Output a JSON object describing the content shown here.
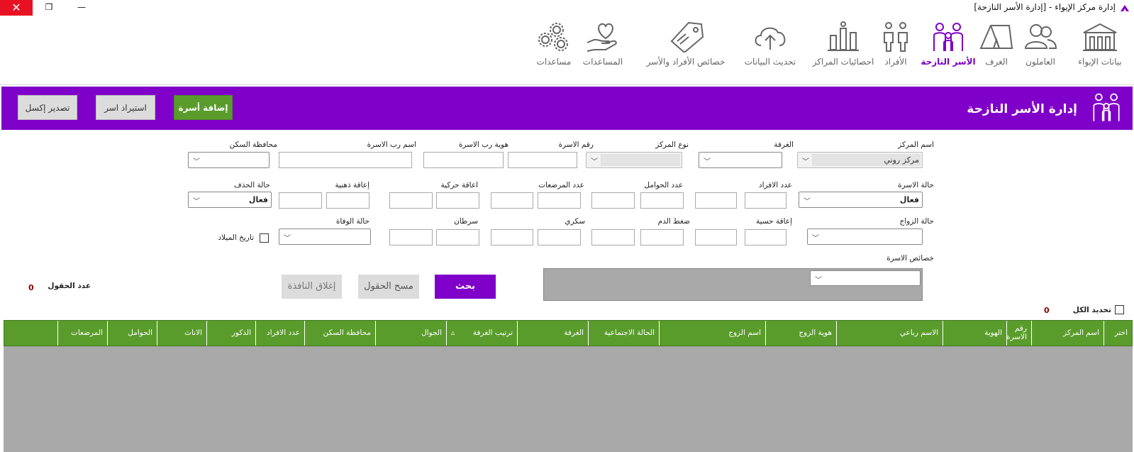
{
  "window": {
    "title": "إدارة مركز الإيواء - [إدارة الأسر النازحة]",
    "close_glyph": "✕",
    "restore_glyph": "❐",
    "minimize_glyph": "—"
  },
  "ribbon": {
    "items": [
      {
        "label": "بيانات الإيواء",
        "icon": "shelter-building-icon"
      },
      {
        "label": "العاملون",
        "icon": "people-icon"
      },
      {
        "label": "الغرف",
        "icon": "tent-icon"
      },
      {
        "label": "الأسر النازحة",
        "icon": "family-icon",
        "active": true
      },
      {
        "label": "الأفراد",
        "icon": "persons-icon"
      },
      {
        "label": "احصائيات المراكز",
        "icon": "bar-chart-icon"
      },
      {
        "label": "تحديث البيانات",
        "icon": "cloud-upload-icon"
      },
      {
        "label": "خصائص الأفراد والأسر",
        "icon": "tag-icon"
      },
      {
        "label": "المساعدات",
        "icon": "heart-hand-icon"
      },
      {
        "label": "مساعدات",
        "icon": "gears-icon"
      }
    ]
  },
  "header": {
    "title": "إدارة الأسر النازحة",
    "add_family": "إضافة أسرة",
    "import_families": "استيراد اسر",
    "export_excel": "تصدير إكسل",
    "accent": "#7f00c8"
  },
  "form": {
    "center_name_label": "اسم المركز",
    "center_name_value": "مركز روني",
    "room_label": "الغرفة",
    "center_type_label": "نوع المركز",
    "family_no_label": "رقم الاسرة",
    "head_id_label": "هوية رب الاسرة",
    "head_name_label": "اسم رب الاسرة",
    "residence_gov_label": "محافظة السكن",
    "family_status_label": "حالة الاسرة",
    "family_status_value": "فعال",
    "members_count_label": "عدد الافراد",
    "pregnant_count_label": "عدد الحوامل",
    "nursing_count_label": "عدد المرضعات",
    "motor_disability_label": "اعاقة حركية",
    "mental_disability_label": "إعاقة ذهنية",
    "deletion_status_label": "حالة الحذف",
    "deletion_status_value": "فعال",
    "marital_status_label": "حالة الزواج",
    "sensory_disability_label": "إعاقة حسية",
    "blood_pressure_label": "ضغط الدم",
    "diabetes_label": "سكري",
    "cancer_label": "سرطان",
    "death_status_label": "حالة الوفاة",
    "birth_date_label": "تاريخ الميلاد",
    "family_traits_label": "خصائص الاسرة",
    "fields_count_label": "عدد الحقول",
    "fields_count_value": "0",
    "search_button": "بحث",
    "clear_fields_button": "مسح الحقول",
    "close_window_button": "إغلاق النافذة",
    "select_all_label": "تحديد الكل",
    "selected_count": "0"
  },
  "grid": {
    "columns": [
      "اختر",
      "اسم المركز",
      "رقم الاسرة",
      "الهوية",
      "الاسم رباعي",
      "هوية الزوج",
      "اسم الزوج",
      "الحالة الاجتماعية",
      "الغرفة",
      "ترتيب الغرفة",
      "الجوال",
      "محافظة السكن",
      "عدد الافراد",
      "الذكور",
      "الاناث",
      "الحوامل",
      "المرضعات"
    ],
    "sort_glyph": "▵",
    "header_color": "#5a9c2c"
  }
}
